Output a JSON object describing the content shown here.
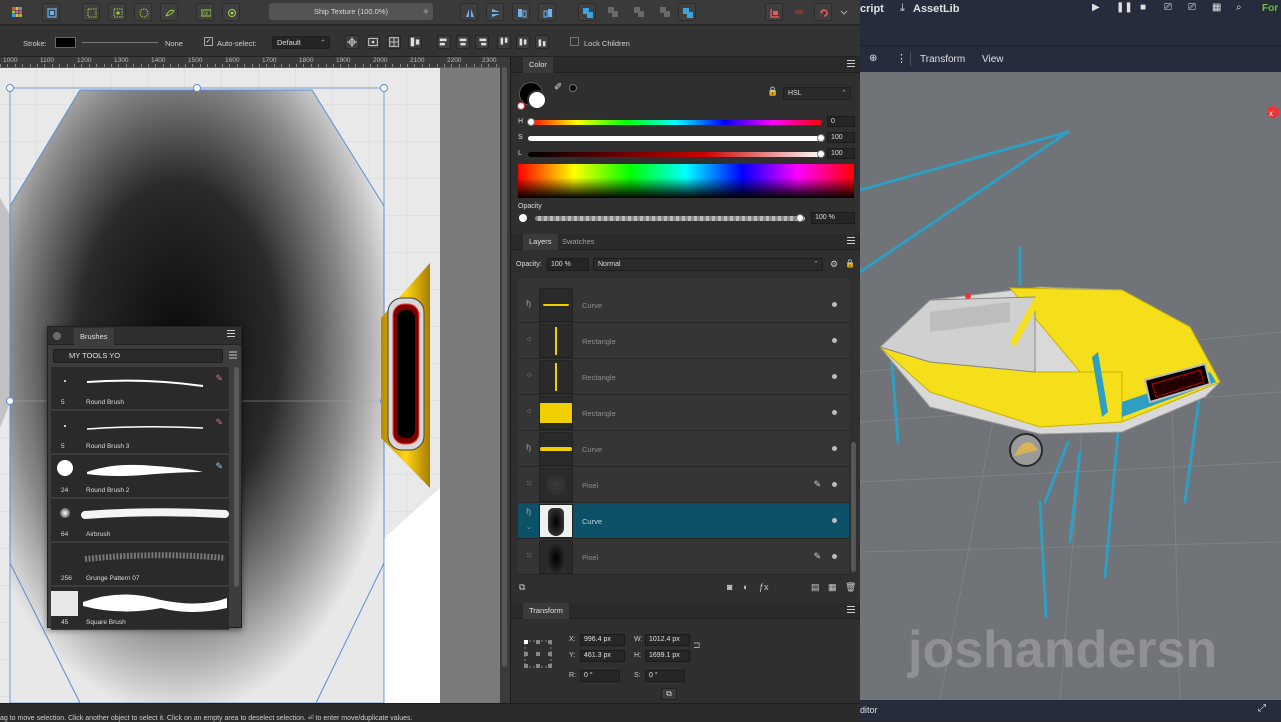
{
  "affinity": {
    "document_title": "Ship Texture (100.0%)",
    "context_toolbar": {
      "stroke_label": "Stroke:",
      "stroke_none": "None",
      "autoselect_label": "Auto-select:",
      "autoselect_value": "Default",
      "lock_children_label": "Lock Children"
    },
    "ruler_labels": [
      "1000",
      "1100",
      "1200",
      "1300",
      "1400",
      "1500",
      "1600",
      "1700",
      "1800",
      "1900",
      "2000",
      "2100",
      "2200",
      "2300"
    ],
    "brushes_panel": {
      "tab": "Brushes",
      "category": "MY TOOLS YO",
      "brushes": [
        {
          "size": "5",
          "name": "Round Brush"
        },
        {
          "size": "5",
          "name": "Round Brush 3"
        },
        {
          "size": "24",
          "name": "Round Brush 2"
        },
        {
          "size": "64",
          "name": "Airbrush"
        },
        {
          "size": "256",
          "name": "Grunge Pattern 07"
        },
        {
          "size": "45",
          "name": "Square Brush"
        }
      ]
    },
    "color_panel": {
      "tab": "Color",
      "model": "HSL",
      "h_label": "H",
      "h_value": "0",
      "s_label": "S",
      "s_value": "100",
      "l_label": "L",
      "l_value": "100",
      "opacity_label": "Opacity",
      "opacity_value": "100 %"
    },
    "layers_panel": {
      "tab_layers": "Layers",
      "tab_swatches": "Swatches",
      "opacity_label": "Opacity:",
      "opacity_value": "100 %",
      "blend_mode": "Normal",
      "layers": [
        {
          "name": "Curve"
        },
        {
          "name": "Rectangle"
        },
        {
          "name": "Rectangle"
        },
        {
          "name": "Rectangle"
        },
        {
          "name": "Curve"
        },
        {
          "name": "Pixel"
        },
        {
          "name": "Curve",
          "selected": true
        },
        {
          "name": "Pixel"
        }
      ]
    },
    "transform_panel": {
      "tab": "Transform",
      "x_label": "X:",
      "x_value": "996.4 px",
      "y_label": "Y:",
      "y_value": "461.3 px",
      "w_label": "W:",
      "w_value": "1012.4 px",
      "h_label": "H:",
      "h_value": "1699.1 px",
      "r_label": "R:",
      "r_value": "0 °",
      "s_label": "S:",
      "s_value": "0 °"
    },
    "status_text": "ag to move selection. Click another object to select it. Click on an empty area to deselect selection. ⏎ to enter move/duplicate values."
  },
  "godot": {
    "script_tab": "cript",
    "assetlib_tab": "AssetLib",
    "right_cut_label": "For",
    "viewport_menu_transform": "Transform",
    "viewport_menu_view": "View",
    "watermark": "joshandersn",
    "bottom_label": "ditor"
  },
  "colors": {
    "accent_blue": "#0c5167",
    "ship_yellow": "#f6e21c",
    "godot_bg": "#262c3b",
    "gizmo_cyan": "#2e9ec2"
  }
}
